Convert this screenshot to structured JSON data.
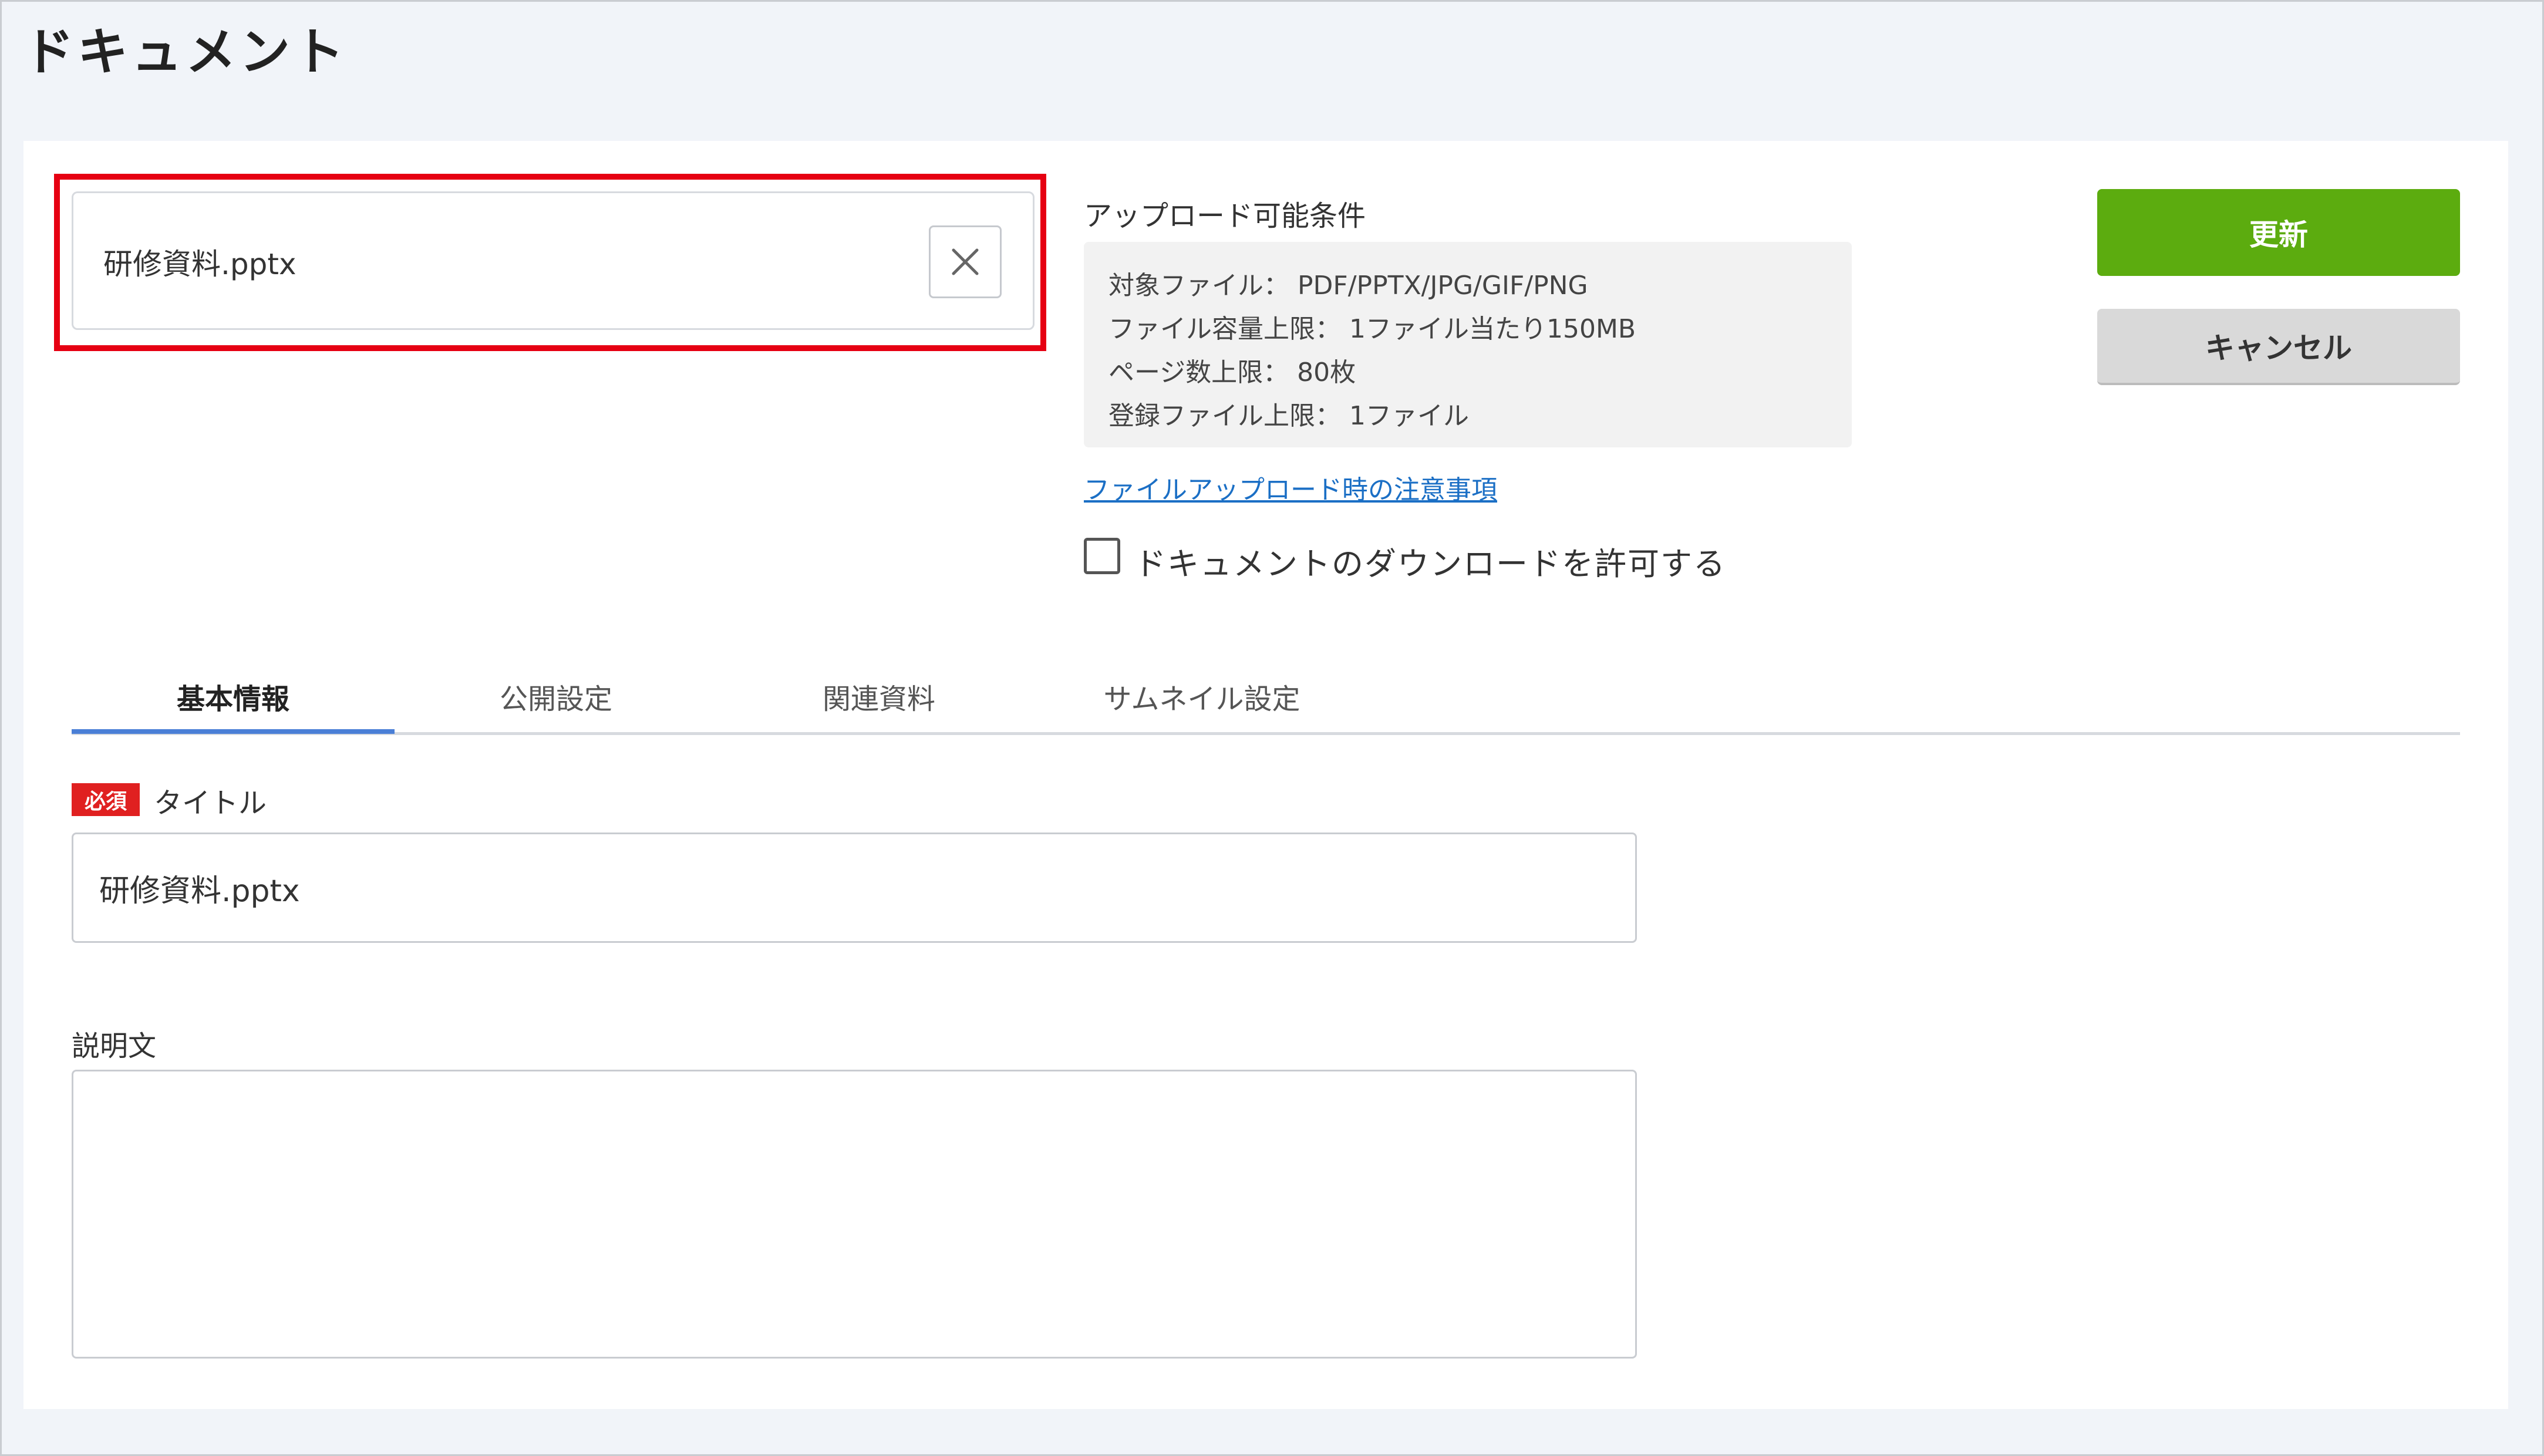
{
  "page": {
    "title": "ドキュメント"
  },
  "upload": {
    "file_name": "研修資料.pptx",
    "clear_icon": "close-icon"
  },
  "conditions": {
    "title": "アップロード可能条件",
    "lines": [
      "対象ファイル： PDF/PPTX/JPG/GIF/PNG",
      "ファイル容量上限： 1ファイル当たり150MB",
      "ページ数上限： 80枚",
      "登録ファイル上限： 1ファイル"
    ],
    "notice_link": "ファイルアップロード時の注意事項"
  },
  "download_permission": {
    "label": "ドキュメントのダウンロードを許可する",
    "checked": false
  },
  "buttons": {
    "update": "更新",
    "cancel": "キャンセル"
  },
  "tabs": [
    {
      "label": "基本情報",
      "active": true
    },
    {
      "label": "公開設定",
      "active": false
    },
    {
      "label": "関連資料",
      "active": false
    },
    {
      "label": "サムネイル設定",
      "active": false
    }
  ],
  "form": {
    "required_badge": "必須",
    "title_label": "タイトル",
    "title_value": "研修資料.pptx",
    "description_label": "説明文",
    "description_value": ""
  },
  "colors": {
    "accent_green": "#5cac0f",
    "highlight_red": "#e60012",
    "tab_active": "#4a7fd6",
    "required_red": "#e02020",
    "link_blue": "#1b6fc5"
  }
}
